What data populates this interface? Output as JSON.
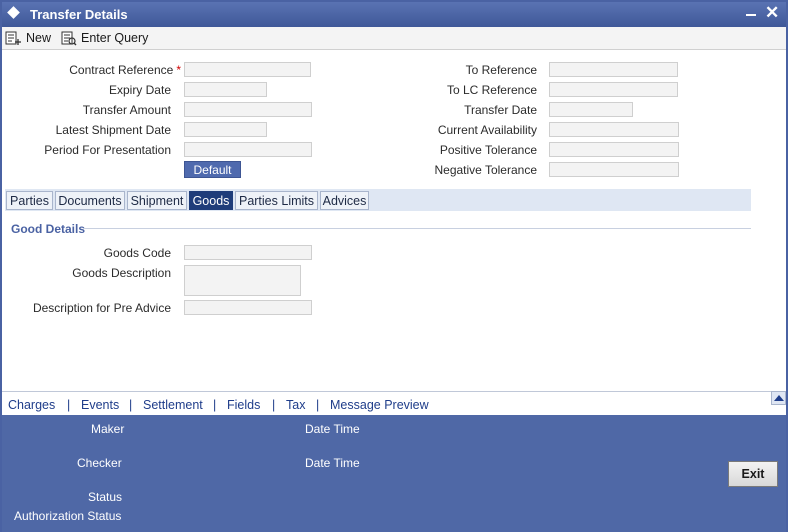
{
  "window": {
    "title": "Transfer Details"
  },
  "toolbar": {
    "new_label": "New",
    "enter_query_label": "Enter Query"
  },
  "form": {
    "left": [
      {
        "label": "Contract Reference",
        "required": "*",
        "value": ""
      },
      {
        "label": "Expiry Date",
        "value": ""
      },
      {
        "label": "Transfer Amount",
        "value": ""
      },
      {
        "label": "Latest Shipment Date",
        "value": ""
      },
      {
        "label": "Period For Presentation",
        "value": ""
      }
    ],
    "right": [
      {
        "label": "To Reference",
        "value": ""
      },
      {
        "label": "To LC Reference",
        "value": ""
      },
      {
        "label": "Transfer Date",
        "value": ""
      },
      {
        "label": "Current Availability",
        "value": ""
      },
      {
        "label": "Positive Tolerance",
        "value": ""
      },
      {
        "label": "Negative Tolerance",
        "value": ""
      }
    ],
    "default_button": "Default"
  },
  "tabs": [
    {
      "label": "Parties"
    },
    {
      "label": "Documents"
    },
    {
      "label": "Shipment"
    },
    {
      "label": "Goods",
      "active": true
    },
    {
      "label": "Parties Limits"
    },
    {
      "label": "Advices"
    }
  ],
  "goods": {
    "section_title": "Good Details",
    "fields": [
      {
        "label": "Goods Code",
        "value": ""
      },
      {
        "label": "Goods Description",
        "value": ""
      },
      {
        "label": "Description for Pre Advice",
        "value": ""
      }
    ]
  },
  "links": [
    "Charges",
    "Events",
    "Settlement",
    "Fields",
    "Tax",
    "Message Preview"
  ],
  "link_separator": "|",
  "footer": {
    "maker": "Maker",
    "checker": "Checker",
    "date_time_1": "Date Time",
    "date_time_2": "Date Time",
    "status": "Status",
    "authorization_status": "Authorization Status",
    "exit_label": "Exit"
  },
  "colors": {
    "title_bar": "#4a62a3",
    "active_tab": "#1f3d7a",
    "footer": "#4f68a6",
    "link": "#1f3d8a",
    "required": "#d00000"
  }
}
